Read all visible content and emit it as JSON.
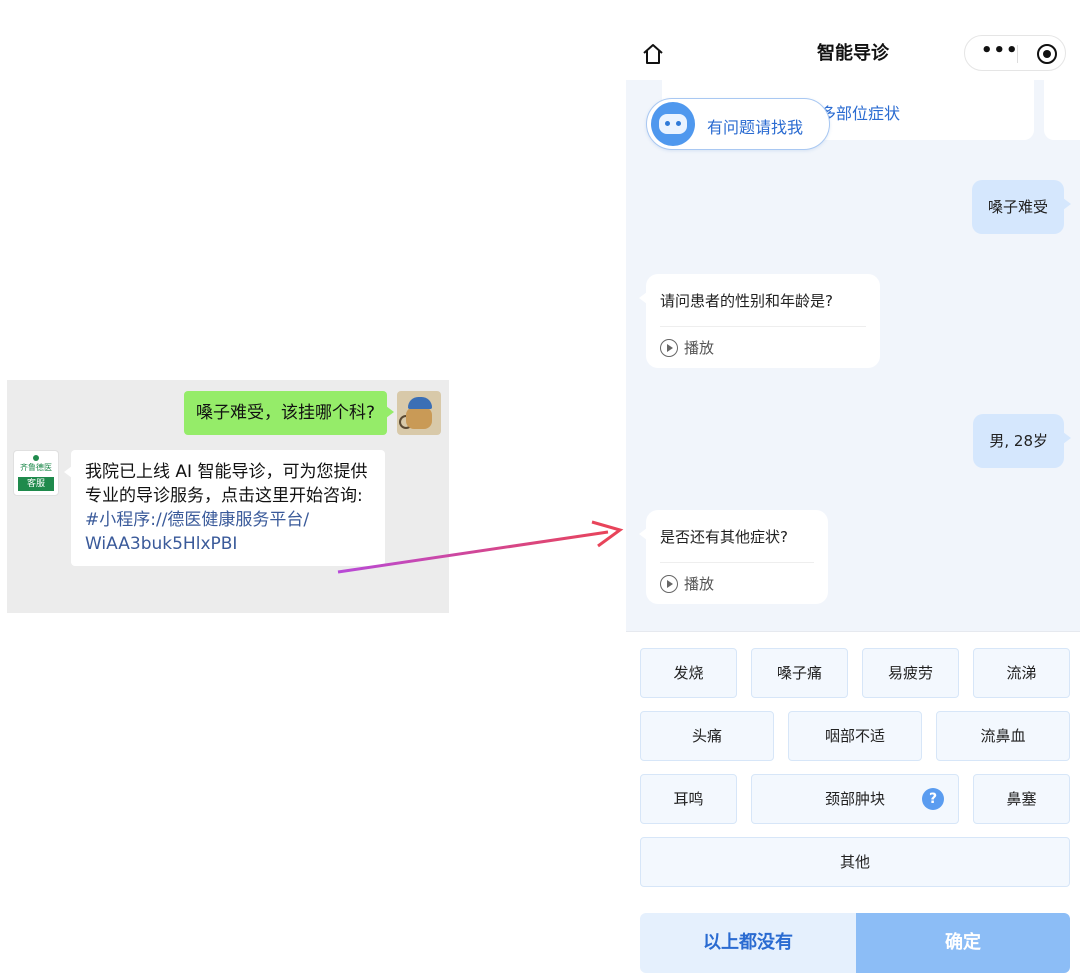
{
  "wechat": {
    "user_message": "嗓子难受，该挂哪个科?",
    "service_avatar": {
      "hospital_name": "齐鲁德医",
      "tag": "客服"
    },
    "service_message": {
      "text": "我院已上线 AI 智能导诊，可为您提供专业的导诊服务，点击这里开始咨询:",
      "link_line1": "#小程序://德医健康服务平台/",
      "link_line2": "WiAA3buk5HlxPBI"
    }
  },
  "arrow": {
    "color_start": "#b84ad8",
    "color_end": "#e8445a"
  },
  "miniprogram": {
    "nav": {
      "title": "智能导诊",
      "more_icon": "more-dots-icon",
      "close_icon": "target-icon",
      "home_icon": "home-icon"
    },
    "top_card_text": "多部位症状",
    "helper_label": "有问题请找我",
    "messages": [
      {
        "side": "right",
        "text": "嗓子难受"
      },
      {
        "side": "left",
        "text": "请问患者的性别和年龄是?",
        "play": "播放"
      },
      {
        "side": "right",
        "text": "男, 28岁"
      },
      {
        "side": "left",
        "text": "是否还有其他症状?",
        "play": "播放"
      }
    ],
    "options": [
      "发烧",
      "嗓子痛",
      "易疲劳",
      "流涕",
      "头痛",
      "咽部不适",
      "流鼻血",
      "耳鸣",
      "颈部肿块",
      "鼻塞",
      "其他"
    ],
    "help_badge": "?",
    "buttons": {
      "none": "以上都没有",
      "confirm": "确定"
    },
    "colors": {
      "accent": "#2a6bd1",
      "user_bubble": "#d5e7fd",
      "confirm": "#8cbdf6"
    }
  }
}
